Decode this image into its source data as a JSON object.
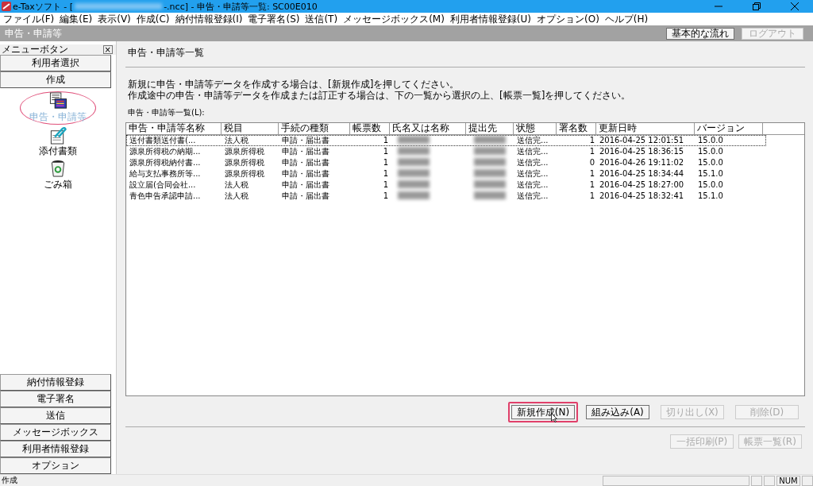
{
  "window": {
    "title_prefix": "e-Taxソフト - [",
    "title_suffix": "-.ncc] - 申告・申請等一覧: SC00E010",
    "title_redacted": true
  },
  "menu": [
    "ファイル(F)",
    "編集(E)",
    "表示(V)",
    "作成(C)",
    "納付情報登録(I)",
    "電子署名(S)",
    "送信(T)",
    "メッセージボックス(M)",
    "利用者情報登録(U)",
    "オプション(O)",
    "ヘルプ(H)"
  ],
  "header": {
    "title": "申告・申請等",
    "buttons": [
      {
        "label": "基本的な流れ",
        "disabled": false
      },
      {
        "label": "ログアウト",
        "disabled": true
      }
    ]
  },
  "sidebar": {
    "title": "メニューボタン",
    "close": "×",
    "top_buttons": [
      "利用者選択",
      "作成"
    ],
    "items": [
      {
        "label": "申告・申請等",
        "kind": "forms",
        "selected": true,
        "highlighted": true
      },
      {
        "label": "添付書類",
        "kind": "attachment",
        "selected": false,
        "highlighted": false
      },
      {
        "label": "ごみ箱",
        "kind": "trash",
        "selected": false,
        "highlighted": false
      }
    ],
    "bottom_buttons": [
      "納付情報登録",
      "電子署名",
      "送信",
      "メッセージボックス",
      "利用者情報登録",
      "オプション"
    ]
  },
  "page": {
    "title": "申告・申請等一覧",
    "instructions": [
      "新規に申告・申請等データを作成する場合は、[新規作成]を押してください。",
      "作成途中の申告・申請等データを作成または訂正する場合は、下の一覧から選択の上、[帳票一覧]を押してください。"
    ],
    "list_label": "申告・申請等一覧(L):"
  },
  "table": {
    "columns": [
      "申告・申請等名称",
      "税目",
      "手続の種類",
      "帳票数",
      "氏名又は名称",
      "提出先",
      "状態",
      "署名数",
      "更新日時",
      "バージョン"
    ],
    "rows": [
      {
        "cells": [
          "送付書類送付書(...",
          "法人税",
          "申請・届出書",
          "1",
          "",
          "",
          "送信完...",
          "1",
          "2016-04-25 12:01:51",
          "15.0.0"
        ],
        "selected": true,
        "redacted": true
      },
      {
        "cells": [
          "源泉所得税の納期...",
          "源泉所得税",
          "申請・届出書",
          "1",
          "",
          "",
          "送信完...",
          "1",
          "2016-04-25 18:36:15",
          "15.0.0"
        ],
        "selected": false,
        "redacted": true
      },
      {
        "cells": [
          "源泉所得税納付書...",
          "源泉所得税",
          "申請・届出書",
          "1",
          "",
          "",
          "送信完...",
          "0",
          "2016-04-26 19:11:02",
          "15.0.0"
        ],
        "selected": false,
        "redacted": true
      },
      {
        "cells": [
          "給与支払事務所等...",
          "源泉所得税",
          "申請・届出書",
          "1",
          "",
          "",
          "送信完...",
          "1",
          "2016-04-25 18:34:44",
          "15.1.0"
        ],
        "selected": false,
        "redacted": true
      },
      {
        "cells": [
          "設立届(合同会社...",
          "法人税",
          "申請・届出書",
          "1",
          "",
          "",
          "送信完...",
          "1",
          "2016-04-25 18:27:00",
          "15.0.0"
        ],
        "selected": false,
        "redacted": true
      },
      {
        "cells": [
          "青色申告承認申請...",
          "法人税",
          "申請・届出書",
          "1",
          "",
          "",
          "送信完...",
          "1",
          "2016-04-25 18:32:41",
          "15.1.0"
        ],
        "selected": false,
        "redacted": true
      }
    ]
  },
  "actions": [
    {
      "label": "新規作成(N)",
      "disabled": false,
      "highlighted": true
    },
    {
      "label": "組み込み(A)",
      "disabled": false,
      "highlighted": false
    },
    {
      "label": "切り出し(X)",
      "disabled": true,
      "highlighted": false
    },
    {
      "label": "削除(D)",
      "disabled": true,
      "highlighted": false
    }
  ],
  "actions2": [
    {
      "label": "一括印刷(P)",
      "disabled": true
    },
    {
      "label": "帳票一覧(R)",
      "disabled": true
    }
  ],
  "status_bar": {
    "text": "作成",
    "indicator": "NUM"
  }
}
